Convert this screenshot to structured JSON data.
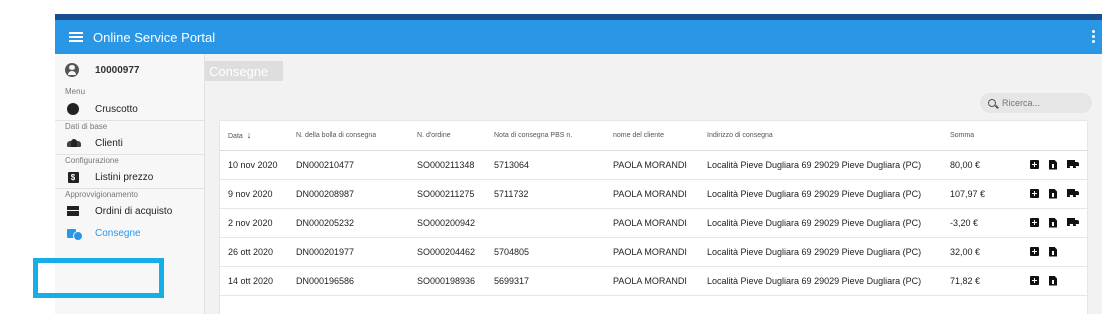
{
  "app": {
    "title": "Online Service Portal"
  },
  "user": {
    "id": "10000977"
  },
  "sidebar": {
    "sections": [
      {
        "label": "Menu",
        "items": [
          {
            "label": "Cruscotto",
            "icon": "dashboard-icon"
          }
        ]
      },
      {
        "label": "Dati di base",
        "items": [
          {
            "label": "Clienti",
            "icon": "people-icon"
          }
        ]
      },
      {
        "label": "Configurazione",
        "items": [
          {
            "label": "Listini prezzo",
            "icon": "dollar-icon"
          }
        ]
      },
      {
        "label": "Approvvigionamento",
        "items": [
          {
            "label": "Ordini di acquisto",
            "icon": "box-icon"
          },
          {
            "label": "Consegne",
            "icon": "delivery-icon",
            "active": true
          }
        ]
      }
    ]
  },
  "page": {
    "title": "Consegne"
  },
  "search": {
    "placeholder": "Ricerca..."
  },
  "table": {
    "columns": [
      "Data",
      "N. della bolla di consegna",
      "N. d'ordine",
      "Nota di consegna PBS n.",
      "nome del cliente",
      "Indirizzo di consegna",
      "Somma"
    ],
    "sort_indicator": "↓",
    "rows": [
      {
        "data": "10 nov 2020",
        "bolla": "DN000210477",
        "ordine": "SO000211348",
        "nota": "5713064",
        "cliente": "PAOLA MORANDI",
        "indirizzo": "Località Pieve Dugliara 69 29029 Pieve Dugliara (PC)",
        "somma": "80,00 €",
        "actions": [
          "add-icon",
          "document-icon",
          "truck-icon"
        ]
      },
      {
        "data": "9 nov 2020",
        "bolla": "DN000208987",
        "ordine": "SO000211275",
        "nota": "5711732",
        "cliente": "PAOLA MORANDI",
        "indirizzo": "Località Pieve Dugliara 69 29029 Pieve Dugliara (PC)",
        "somma": "107,97 €",
        "actions": [
          "add-icon",
          "document-icon",
          "truck-icon"
        ]
      },
      {
        "data": "2 nov 2020",
        "bolla": "DN000205232",
        "ordine": "SO000200942",
        "nota": "",
        "cliente": "PAOLA MORANDI",
        "indirizzo": "Località Pieve Dugliara 69 29029 Pieve Dugliara (PC)",
        "somma": "-3,20 €",
        "actions": [
          "add-icon",
          "document-icon",
          "truck-icon"
        ]
      },
      {
        "data": "26 ott 2020",
        "bolla": "DN000201977",
        "ordine": "SO000204462",
        "nota": "5704805",
        "cliente": "PAOLA MORANDI",
        "indirizzo": "Località Pieve Dugliara 69 29029 Pieve Dugliara (PC)",
        "somma": "32,00 €",
        "actions": [
          "add-icon",
          "document-icon"
        ]
      },
      {
        "data": "14 ott 2020",
        "bolla": "DN000196586",
        "ordine": "SO000198936",
        "nota": "5699317",
        "cliente": "PAOLA MORANDI",
        "indirizzo": "Località Pieve Dugliara 69 29029 Pieve Dugliara (PC)",
        "somma": "71,82 €",
        "actions": [
          "add-icon",
          "document-icon"
        ]
      }
    ]
  },
  "colors": {
    "appbar": "#2a97e6",
    "stripe": "#1a4f8f",
    "highlight": "#17aee8",
    "active_text": "#2a97e6"
  }
}
